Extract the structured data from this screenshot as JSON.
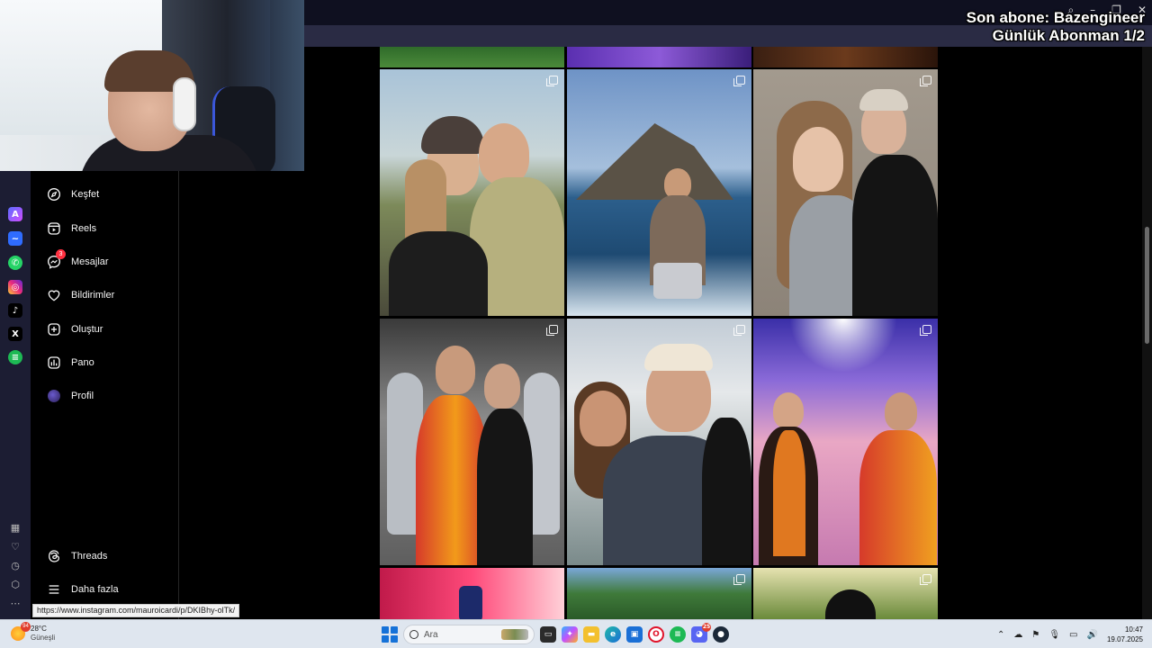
{
  "overlay": {
    "line1": "Son abone: Bazengineer",
    "line2": "Günlük Abonman 1/2"
  },
  "sidebar": {
    "items": [
      {
        "label": "Keşfet",
        "icon": "compass-icon"
      },
      {
        "label": "Reels",
        "icon": "reels-icon"
      },
      {
        "label": "Mesajlar",
        "icon": "messenger-icon",
        "badge": "3"
      },
      {
        "label": "Bildirimler",
        "icon": "heart-icon"
      },
      {
        "label": "Oluştur",
        "icon": "plus-square-icon"
      },
      {
        "label": "Pano",
        "icon": "dashboard-icon"
      },
      {
        "label": "Profil",
        "icon": "avatar"
      }
    ],
    "threads_label": "Threads",
    "more_label": "Daha fazla"
  },
  "side_apps": [
    "aria-icon",
    "messenger-icon",
    "whatsapp-icon",
    "instagram-icon",
    "tiktok-icon",
    "x-icon",
    "spotify-icon"
  ],
  "status_url": "https://www.instagram.com/mauroicardi/p/DKIBhy-olTk/",
  "taskbar": {
    "weather_temp": "28°C",
    "weather_desc": "Güneşli",
    "weather_badge": "94",
    "search_placeholder": "Ara",
    "discord_badge": "25",
    "time": "10:47",
    "date": "19.07.2025"
  },
  "colors": {
    "instagram_badge": "#ff3040",
    "side_bar_bg": "#1c1d33",
    "taskbar_bg": "#dfe6ef"
  }
}
